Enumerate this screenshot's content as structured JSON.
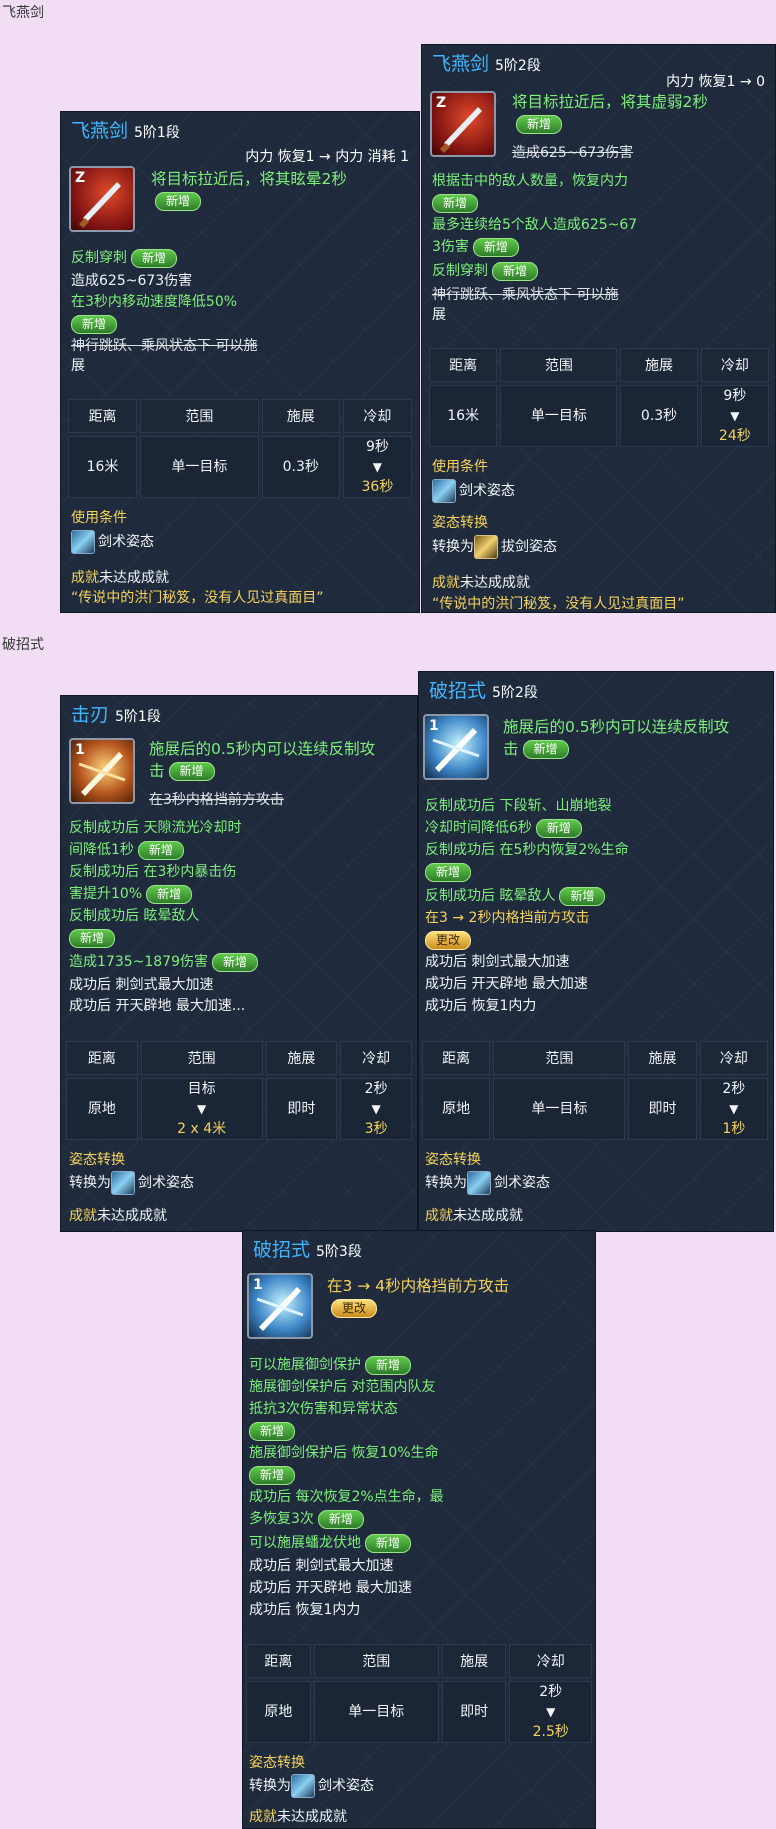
{
  "sections": {
    "flying_swallow": "飞燕剑",
    "counter_style": "破招式"
  },
  "stats_headers": [
    "距离",
    "范围",
    "施展",
    "冷却"
  ],
  "common": {
    "condition_label": "使用条件",
    "stance_label": "剑术姿态",
    "stance_change_label": "姿态转换",
    "convert_to": "转换为",
    "achievement_label": "成就",
    "achievement_text": "未达成成就",
    "quote": "“传说中的洪门秘笈，没有人见过真面目”",
    "new": "新增",
    "change": "更改",
    "arrow": "▼"
  },
  "card1": {
    "name": "飞燕剑",
    "rank": "5阶1段",
    "key": "Z",
    "cost": "内力 恢复1 → 内力 消耗 1",
    "main_text": "将目标拉近后，将其眩晕2秒",
    "lines": [
      "反制穿刺",
      "造成625~673伤害",
      "在3秒内移动速度降低50%",
      "神行跳跃、乘风状态下 可以施",
      "展"
    ],
    "stats": {
      "distance": "16米",
      "range": "单一目标",
      "cast": "0.3秒",
      "cd_old": "9秒",
      "cd_new": "36秒"
    }
  },
  "card2": {
    "name": "飞燕剑",
    "rank": "5阶2段",
    "key": "Z",
    "cost": "内力 恢复1 → 0",
    "main_text": "将目标拉近后，将其虚弱2秒",
    "lines": [
      "造成625~673伤害",
      "根据击中的敌人数量，恢复内力",
      "最多连续给5个敌人造成625~67",
      "3伤害",
      "反制穿刺",
      "神行跳跃、乘风状态下 可以施",
      "展"
    ],
    "stats": {
      "distance": "16米",
      "range": "单一目标",
      "cast": "0.3秒",
      "cd_old": "9秒",
      "cd_new": "24秒"
    },
    "convert_stance": "拔剑姿态"
  },
  "card3": {
    "name": "击刃",
    "rank": "5阶1段",
    "key": "1",
    "main_text_1": "施展后的0.5秒内可以连续反制攻",
    "main_text_2": "击",
    "strike": "在3秒内格挡前方攻击",
    "lines": [
      "反制成功后 天隙流光冷却时",
      "间降低1秒",
      "反制成功后 在3秒内暴击伤",
      "害提升10%",
      "反制成功后 眩晕敌人",
      "造成1735~1879伤害",
      "成功后 刺剑式最大加速",
      "成功后 开天辟地 最大加速..."
    ],
    "stats": {
      "distance": "原地",
      "range_top": "目标",
      "range_bottom": "2 x 4米",
      "cast": "即时",
      "cd_old": "2秒",
      "cd_new": "3秒"
    }
  },
  "card4": {
    "name": "破招式",
    "rank": "5阶2段",
    "key": "1",
    "main_text_1": "施展后的0.5秒内可以连续反制攻",
    "main_text_2": "击",
    "lines": [
      "反制成功后 下段斩、山崩地裂",
      "冷却时间降低6秒",
      "反制成功后 在5秒内恢复2%生命",
      "反制成功后 眩晕敌人",
      "在3 → 2秒内格挡前方攻击",
      "成功后 刺剑式最大加速",
      "成功后 开天辟地 最大加速",
      "成功后 恢复1内力"
    ],
    "stats": {
      "distance": "原地",
      "range": "单一目标",
      "cast": "即时",
      "cd_old": "2秒",
      "cd_new": "1秒"
    }
  },
  "card5": {
    "name": "破招式",
    "rank": "5阶3段",
    "key": "1",
    "main_text": "在3 → 4秒内格挡前方攻击",
    "lines": [
      "可以施展御剑保护",
      "施展御剑保护后 对范围内队友",
      "抵抗3次伤害和异常状态",
      "施展御剑保护后 恢复10%生命",
      "成功后 每次恢复2%点生命，最",
      "多恢复3次",
      "可以施展蟠龙伏地",
      "成功后 刺剑式最大加速",
      "成功后 开天辟地 最大加速",
      "成功后 恢复1内力"
    ],
    "stats": {
      "distance": "原地",
      "range": "单一目标",
      "cast": "即时",
      "cd_old": "2秒",
      "cd_new": "2.5秒"
    }
  },
  "colors": {
    "accent": "#3fb6ff",
    "positive": "#7ef07a",
    "highlight": "#f5d35a",
    "panel": "#1f2b3d"
  },
  "icons": [
    "flying-sword-icon",
    "counter-sword-icon",
    "stance-icon"
  ]
}
